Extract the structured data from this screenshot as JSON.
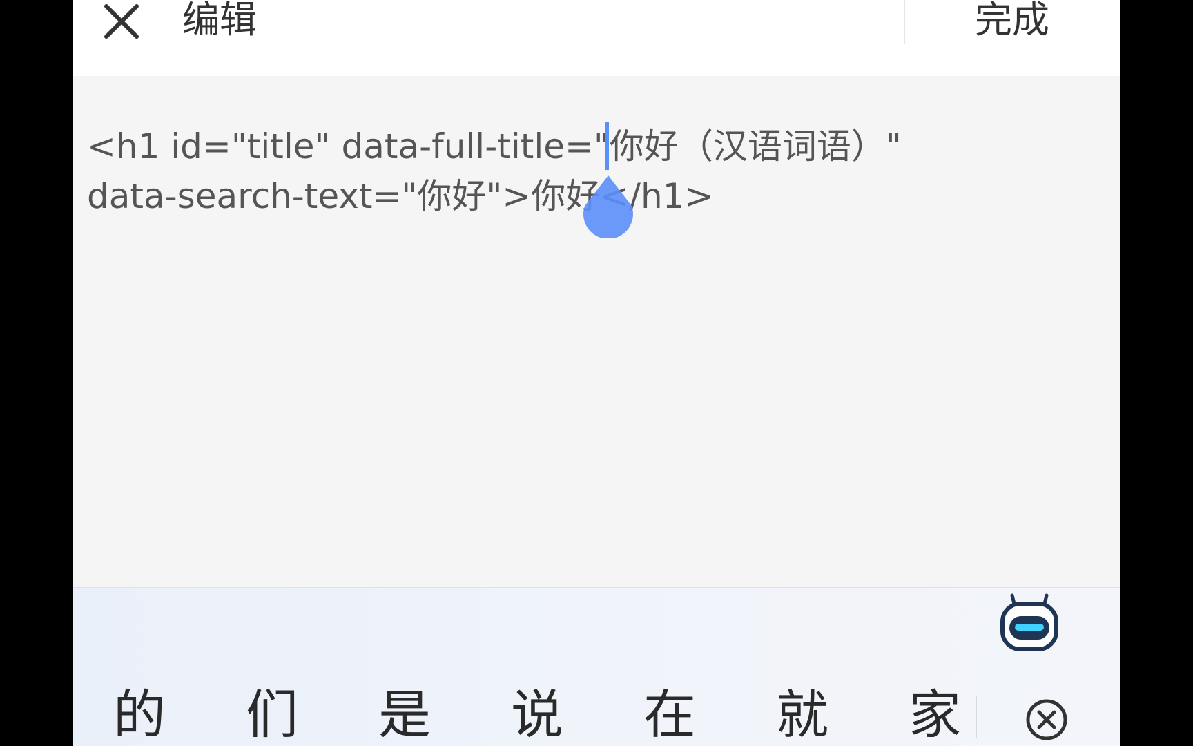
{
  "header": {
    "title": "编辑",
    "done_label": "完成"
  },
  "editor": {
    "line_1": "<h1 id=\"title\" data-full-title=\"你好（汉语词语）\"",
    "line_2": "data-search-text=\"你好\">你好</h1>"
  },
  "candidates": [
    "的",
    "们",
    "是",
    "说",
    "在",
    "就",
    "家"
  ],
  "icons": {
    "close": "close-icon",
    "cursor_handle": "teardrop-cursor-handle-icon",
    "assistant": "robot-assistant-icon",
    "clear": "clear-circle-x-icon"
  },
  "colors": {
    "accent": "#5b8ff9",
    "text": "#333333",
    "editor_bg": "#f5f5f5"
  }
}
